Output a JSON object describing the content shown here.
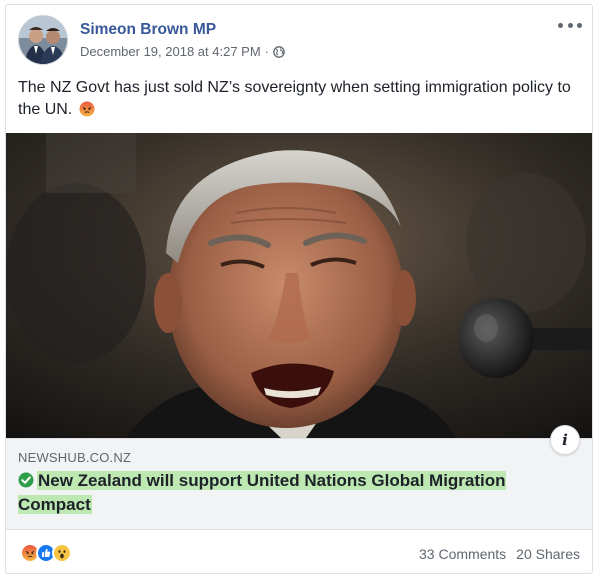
{
  "post": {
    "author": "Simeon Brown MP",
    "timestamp": "December 19, 2018 at 4:27 PM",
    "separator": "·",
    "privacy_icon": "globe-icon",
    "text": "The NZ Govt has just sold NZ’s sovereignty when setting immigration policy to the UN.",
    "text_emoji": "angry-emoji",
    "options_icon": "more-options-icon"
  },
  "link_preview": {
    "domain": "NEWSHUB.CO.NZ",
    "headline": "New Zealand will support United Nations Global Migration Compact",
    "headline_icon": "check-circle-icon",
    "highlight_color": "#bde8b2",
    "info_label": "i"
  },
  "footer": {
    "reactions": [
      "angry",
      "like",
      "wow"
    ],
    "comments": "33 Comments",
    "shares": "20 Shares"
  },
  "colors": {
    "author_link": "#385898",
    "secondary_text": "#616770",
    "link_bg": "#f2f3f5"
  }
}
